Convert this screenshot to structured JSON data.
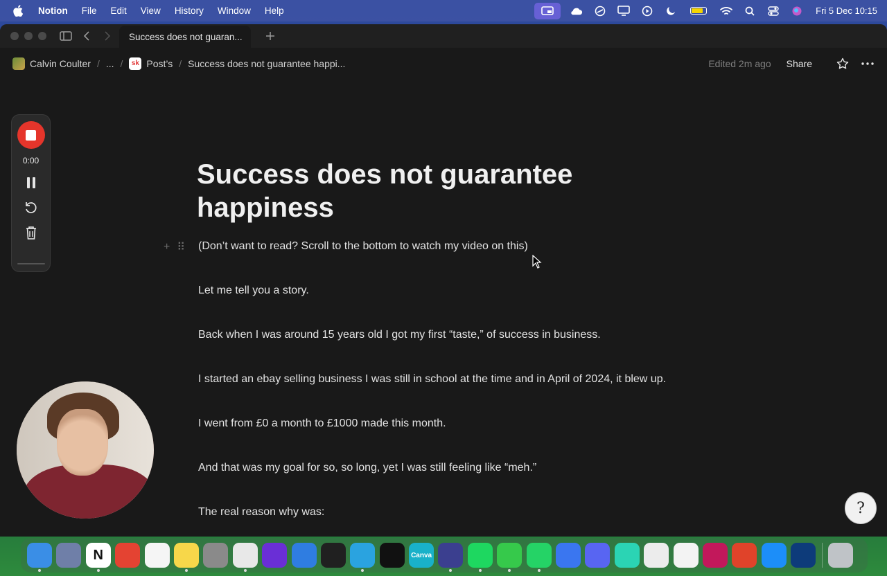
{
  "menubar": {
    "app_name": "Notion",
    "menus": [
      "File",
      "Edit",
      "View",
      "History",
      "Window",
      "Help"
    ],
    "clock": "Fri 5 Dec  10:15"
  },
  "window": {
    "tab_title": "Success does not guaran...",
    "breadcrumb": {
      "workspace": "Calvin Coulter",
      "ellipsis": "...",
      "parent_logo_text": "sk",
      "parent": "Post’s",
      "current": "Success does not guarantee happi..."
    },
    "edited": "Edited 2m ago",
    "share_label": "Share"
  },
  "page": {
    "title": "Success does not guarantee happiness",
    "paragraphs": [
      "(Don’t want to read? Scroll to the bottom to watch my video on this)",
      "Let me tell you a story.",
      "Back when I was around 15 years old I got my first “taste,” of success in business.",
      "I started an ebay selling business I was still in school at the time and in April of 2024, it blew up.",
      "I went from £0 a month to £1000 made this month.",
      "And that was my goal for so, so long, yet I was still feeling like “meh.”",
      "The real reason why was:"
    ]
  },
  "recorder": {
    "time": "0:00"
  },
  "dock": {
    "apps": [
      {
        "name": "finder",
        "color": "#3a8ee6",
        "label": ""
      },
      {
        "name": "launchpad",
        "color": "#6f7fa8",
        "label": ""
      },
      {
        "name": "notion",
        "color": "#ffffff",
        "label": "N"
      },
      {
        "name": "todoist",
        "color": "#e44332",
        "label": ""
      },
      {
        "name": "reminders",
        "color": "#f5f5f5",
        "label": ""
      },
      {
        "name": "notes",
        "color": "#f7d74a",
        "label": ""
      },
      {
        "name": "system-settings",
        "color": "#8a8a8a",
        "label": ""
      },
      {
        "name": "chrome",
        "color": "#e8e8e8",
        "label": ""
      },
      {
        "name": "arc",
        "color": "#6a2fd6",
        "label": ""
      },
      {
        "name": "instruments",
        "color": "#2f7de1",
        "label": ""
      },
      {
        "name": "capcut-audio",
        "color": "#202020",
        "label": ""
      },
      {
        "name": "telegram",
        "color": "#2aa3e0",
        "label": ""
      },
      {
        "name": "capcut",
        "color": "#111111",
        "label": ""
      },
      {
        "name": "canva",
        "color": "#19b1c9",
        "label": "Canva"
      },
      {
        "name": "vpn",
        "color": "#3b3f8f",
        "label": ""
      },
      {
        "name": "spotify",
        "color": "#1ed760",
        "label": ""
      },
      {
        "name": "messages",
        "color": "#36c94b",
        "label": ""
      },
      {
        "name": "whatsapp",
        "color": "#25d366",
        "label": ""
      },
      {
        "name": "signal",
        "color": "#3a76f0",
        "label": ""
      },
      {
        "name": "discord",
        "color": "#5865f2",
        "label": ""
      },
      {
        "name": "screen-studio",
        "color": "#2bd4b4",
        "label": ""
      },
      {
        "name": "claude-like",
        "color": "#ececec",
        "label": ""
      },
      {
        "name": "photos",
        "color": "#f3f3f3",
        "label": ""
      },
      {
        "name": "cleanshot",
        "color": "#c2185b",
        "label": ""
      },
      {
        "name": "feather",
        "color": "#e0432a",
        "label": ""
      },
      {
        "name": "app-store",
        "color": "#1c8ef9",
        "label": ""
      },
      {
        "name": "final-cut",
        "color": "#0d3b7a",
        "label": ""
      }
    ],
    "trash": {
      "name": "trash",
      "color": "#bfc3c7"
    }
  }
}
